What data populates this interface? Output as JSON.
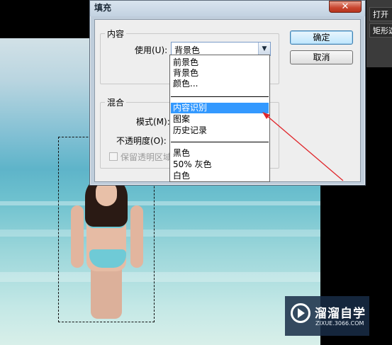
{
  "dialog": {
    "title": "填充",
    "close_glyph": "✕",
    "content_group": {
      "legend": "内容",
      "use_label": "使用(U):",
      "use_value": "背景色"
    },
    "blend_group": {
      "legend": "混合",
      "mode_label": "模式(M):",
      "opacity_label": "不透明度(O):",
      "preserve_label": "保留透明区域"
    },
    "ok_button": "确定",
    "cancel_button": "取消"
  },
  "dropdown": {
    "selected": "内容识别",
    "options": [
      "前景色",
      "背景色",
      "颜色...",
      "内容识别",
      "图案",
      "历史记录",
      "黑色",
      "50% 灰色",
      "白色"
    ]
  },
  "right_panel": {
    "open_button": "打开",
    "rect_button": "矩形选"
  },
  "watermark": {
    "name": "溜溜自学",
    "url": "ZIXUE.3066.COM"
  },
  "colors": {
    "dialog_bg": "#eeeeee",
    "frame": "#bfcddb",
    "selection": "#3399ff",
    "arrow": "#e0262b",
    "close": "#c8452e"
  }
}
